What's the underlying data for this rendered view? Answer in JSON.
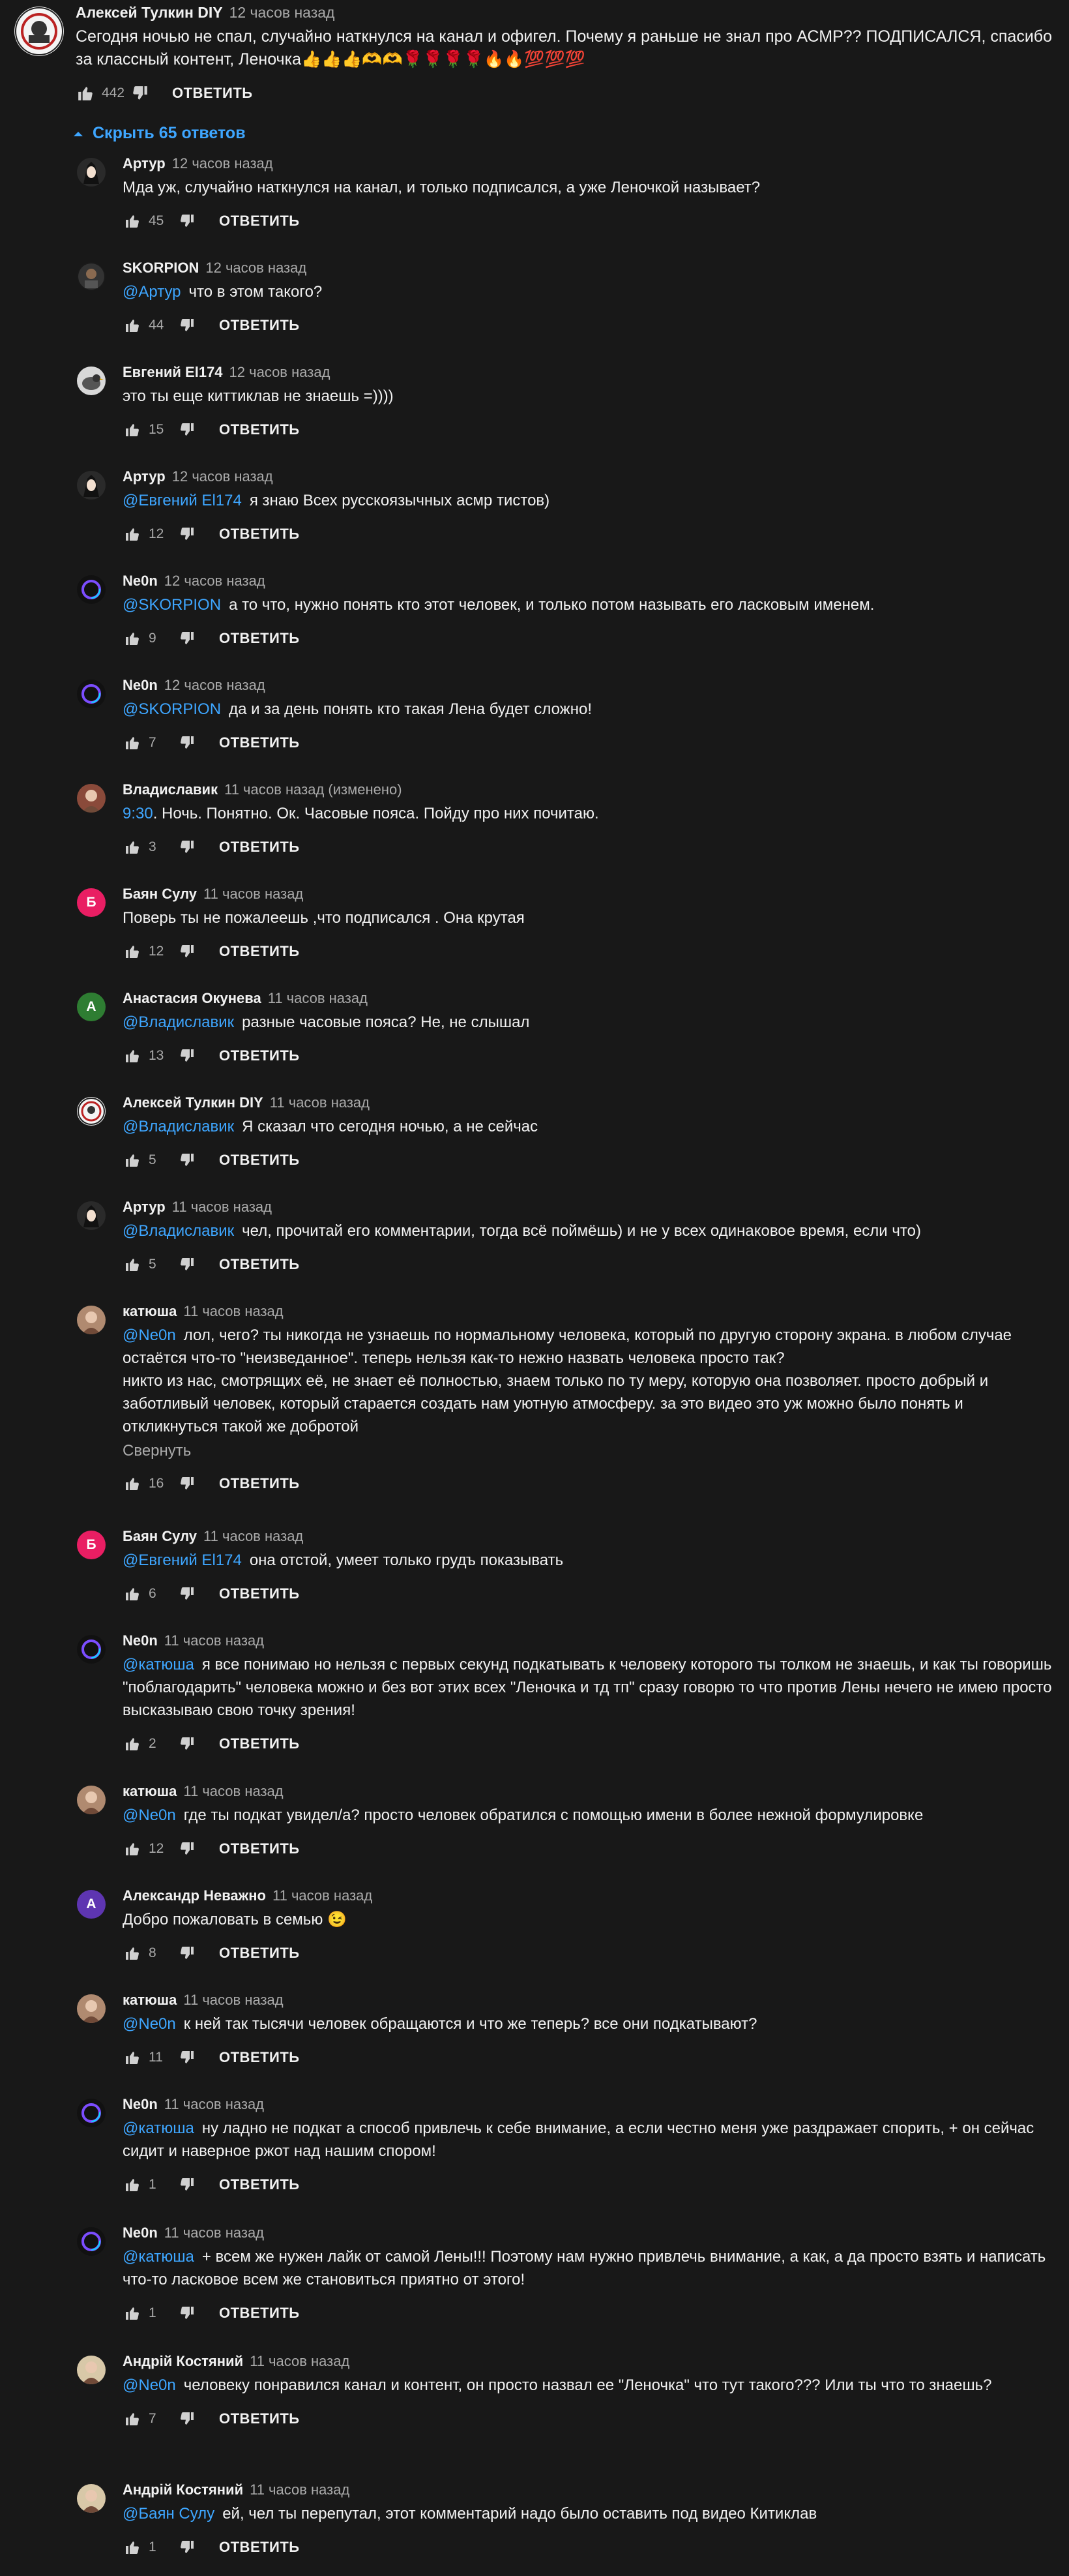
{
  "icons": {
    "like": "thumbs-up-icon",
    "dislike": "thumbs-down-icon",
    "collapse": "chevron-up-icon"
  },
  "colors": {
    "background": "#181818",
    "link": "#3ea6ff",
    "secondary_text": "#aaaaaa"
  },
  "top_comment": {
    "author": "Алексей Тулкин DIY",
    "time": "12 часов назад",
    "text": "Сегодня ночью не спал, случайно наткнулся на канал и офигел. Почему я раньше не знал про АСМР?? ПОДПИСАЛСЯ, спасибо за классный контент, Леночка👍👍👍🫶🫶🌹🌹🌹🌹🔥🔥💯💯💯",
    "likes": "442",
    "reply_label": "ОТВЕТИТЬ"
  },
  "replies_toggle": "Скрыть 65 ответов",
  "collapse_label": "Свернуть",
  "replies": [
    {
      "author": "Артур",
      "time": "12 часов назад",
      "mention": "",
      "text": "Мда уж, случайно наткнулся на канал, и только подписался, а уже Леночкой называет?",
      "likes": "45",
      "reply_label": "ОТВЕТИТЬ"
    },
    {
      "author": "SKORPION",
      "time": "12 часов назад",
      "mention": "@Артур",
      "text": "что в этом такого?",
      "likes": "44",
      "reply_label": "ОТВЕТИТЬ"
    },
    {
      "author": "Евгений El174",
      "time": "12 часов назад",
      "mention": "",
      "text": "это ты еще киттиклав не знаешь =))))",
      "likes": "15",
      "reply_label": "ОТВЕТИТЬ"
    },
    {
      "author": "Артур",
      "time": "12 часов назад",
      "mention": "@Евгений El174",
      "text": "я знаю Всех русскоязычных асмр тистов)",
      "likes": "12",
      "reply_label": "ОТВЕТИТЬ"
    },
    {
      "author": "Ne0n",
      "time": "12 часов назад",
      "mention": "@SKORPION",
      "text": "а то что, нужно понять кто этот человек, и только потом называть его ласковым именем.",
      "likes": "9",
      "reply_label": "ОТВЕТИТЬ"
    },
    {
      "author": "Ne0n",
      "time": "12 часов назад",
      "mention": "@SKORPION",
      "text": "да и за день понять кто такая Лена будет сложно!",
      "likes": "7",
      "reply_label": "ОТВЕТИТЬ"
    },
    {
      "author": "Владиславик",
      "time": "11 часов назад (изменено)",
      "timestamp_link": "9:30",
      "mention": "",
      "text": ". Ночь. Понятно. Ок. Часовые пояса. Пойду про них почитаю.",
      "likes": "3",
      "reply_label": "ОТВЕТИТЬ"
    },
    {
      "author": "Баян Сулу",
      "time": "11 часов назад",
      "mention": "",
      "text": "Поверь ты не пожалеешь ,что подписался . Она крутая",
      "likes": "12",
      "reply_label": "ОТВЕТИТЬ"
    },
    {
      "author": "Анастасия Окунева",
      "time": "11 часов назад",
      "mention": "@Владиславик",
      "text": "разные часовые пояса? Не, не слышал",
      "likes": "13",
      "reply_label": "ОТВЕТИТЬ"
    },
    {
      "author": "Алексей Тулкин DIY",
      "time": "11 часов назад",
      "mention": "@Владиславик",
      "text": "Я сказал что сегодня ночью, а не сейчас",
      "likes": "5",
      "reply_label": "ОТВЕТИТЬ"
    },
    {
      "author": "Артур",
      "time": "11 часов назад",
      "mention": "@Владиславик",
      "text": "чел, прочитай его комментарии, тогда всё поймёшь) и не у всех одинаковое время, если что)",
      "likes": "5",
      "reply_label": "ОТВЕТИТЬ"
    },
    {
      "author": "катюша",
      "time": "11 часов назад",
      "mention": "@Ne0n",
      "text": "лол, чего? ты никогда не узнаешь по нормальному человека, который по другую сторону экрана. в любом случае остаётся что-то \"неизведанное\". теперь нельзя как-то нежно назвать человека просто так?\nникто из нас, смотрящих её, не знает её полностью, знаем только по ту меру, которую она позволяет. просто добрый и заботливый человек, который старается создать нам уютную атмосферу. за это видео это уж можно было понять и откликнуться такой же добротой",
      "likes": "16",
      "reply_label": "ОТВЕТИТЬ",
      "collapse": true
    },
    {
      "author": "Баян Сулу",
      "time": "11 часов назад",
      "mention": "@Евгений El174",
      "text": "она отстой, умеет только грудъ показывать",
      "likes": "6",
      "reply_label": "ОТВЕТИТЬ"
    },
    {
      "author": "Ne0n",
      "time": "11 часов назад",
      "mention": "@катюша",
      "text": "я все понимаю но нельзя с первых секунд подкатывать к человеку которого ты толком не знаешь, и как ты говоришь \"поблагодарить\" человека можно и без вот этих всех \"Леночка и тд тп\" сразу говорю то что против Лены нечего не имею просто высказываю свою точку зрения!",
      "likes": "2",
      "reply_label": "ОТВЕТИТЬ"
    },
    {
      "author": "катюша",
      "time": "11 часов назад",
      "mention": "@Ne0n",
      "text": "где ты подкат увидел/а? просто человек обратился с помощью имени в более нежной формулировке",
      "likes": "12",
      "reply_label": "ОТВЕТИТЬ"
    },
    {
      "author": "Александр Неважно",
      "time": "11 часов назад",
      "mention": "",
      "text": "Добро пожаловать в семью 😉",
      "likes": "8",
      "reply_label": "ОТВЕТИТЬ"
    },
    {
      "author": "катюша",
      "time": "11 часов назад",
      "mention": "@Ne0n",
      "text": "к ней так тысячи человек обращаются и что же теперь? все они подкатывают?",
      "likes": "11",
      "reply_label": "ОТВЕТИТЬ"
    },
    {
      "author": "Ne0n",
      "time": "11 часов назад",
      "mention": "@катюша",
      "text": "ну ладно не подкат а способ привлечь к себе внимание, а если честно меня уже раздражает спорить, + он сейчас сидит и наверное ржот над нашим спором!",
      "likes": "1",
      "reply_label": "ОТВЕТИТЬ"
    },
    {
      "author": "Ne0n",
      "time": "11 часов назад",
      "mention": "@катюша",
      "text": "+ всем же нужен лайк от самой Лены!!! Поэтому нам нужно привлечь внимание, а как, а да просто взять и написать что-то ласковое всем же становиться приятно от этого!",
      "likes": "1",
      "reply_label": "ОТВЕТИТЬ"
    },
    {
      "author": "Андрій Костяний",
      "time": "11 часов назад",
      "mention": "@Ne0n",
      "text": "человеку понравился канал и контент, он просто назвал ее \"Леночка\" что тут такого??? Или ты что то знаешь?",
      "likes": "7",
      "reply_label": "ОТВЕТИТЬ"
    },
    {
      "author": "Андрій Костяний",
      "time": "11 часов назад",
      "mention": "@Баян Сулу",
      "text": "ей, чел ты перепутал, этот комментарий надо было оставить под видео Китиклав",
      "likes": "1",
      "reply_label": "ОТВЕТИТЬ"
    }
  ]
}
